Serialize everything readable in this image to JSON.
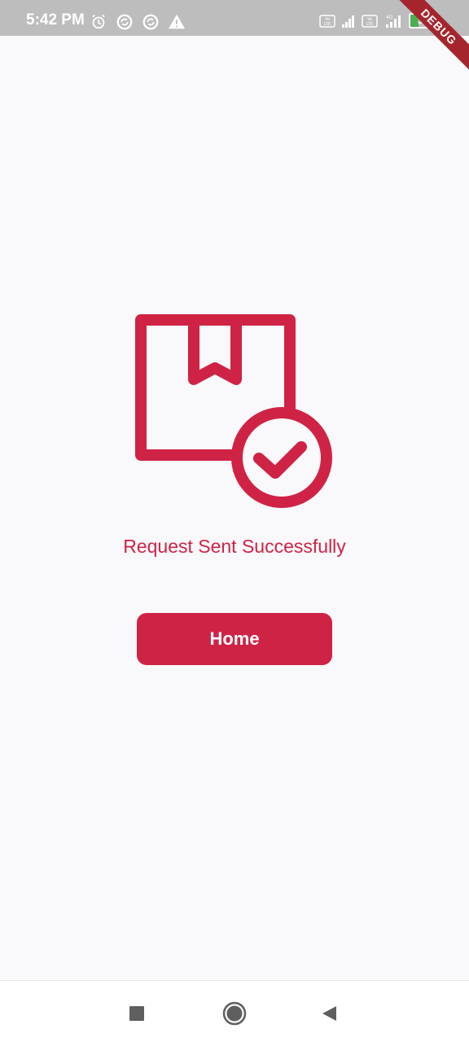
{
  "status_bar": {
    "time": "5:42 PM",
    "left_icons": [
      "alarm-icon",
      "sync-icon",
      "sync-icon",
      "warning-icon"
    ],
    "right_icons": [
      "volte-icon",
      "signal-icon",
      "volte-icon",
      "signal-4g-icon"
    ],
    "network_label": "4G",
    "battery_level": "34"
  },
  "debug_banner": "DEBUG",
  "main": {
    "icon": "package-check-icon",
    "message": "Request Sent Successfully",
    "home_button_label": "Home"
  },
  "nav_bar": {
    "buttons": [
      "recents-square-icon",
      "home-circle-icon",
      "back-triangle-icon"
    ]
  },
  "colors": {
    "accent": "#cf2346",
    "background": "#f9f8fa",
    "status_bar": "#bdbdbd"
  }
}
